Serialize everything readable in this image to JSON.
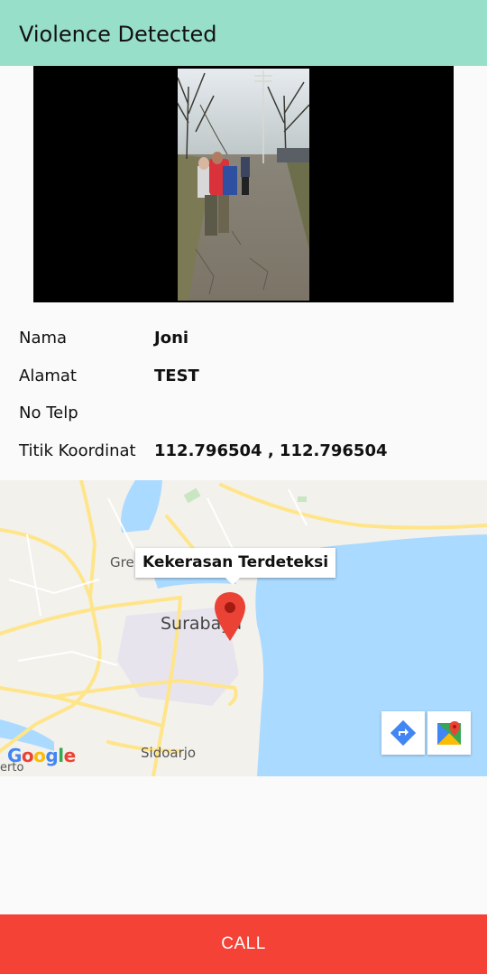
{
  "appbar": {
    "title": "Violence Detected"
  },
  "details": {
    "rows": [
      {
        "label": "Nama",
        "value": "Joni"
      },
      {
        "label": "Alamat",
        "value": "TEST"
      },
      {
        "label": "No Telp",
        "value": ""
      },
      {
        "label": "Titik Koordinat",
        "value": "112.796504 , 112.796504"
      }
    ]
  },
  "map": {
    "marker_title": "Kekerasan Terdeteksi",
    "place_labels": [
      "Gre",
      "Surabaya",
      "Sidoarjo",
      "erto"
    ],
    "attribution": "Google",
    "icons": [
      "directions-icon",
      "google-maps-icon"
    ],
    "colors": {
      "water": "#aadaff",
      "land": "#f3f1ec",
      "road": "#ffe58a",
      "marker": "#ea4335"
    }
  },
  "call_button": {
    "label": "CALL",
    "color": "#f44336"
  }
}
